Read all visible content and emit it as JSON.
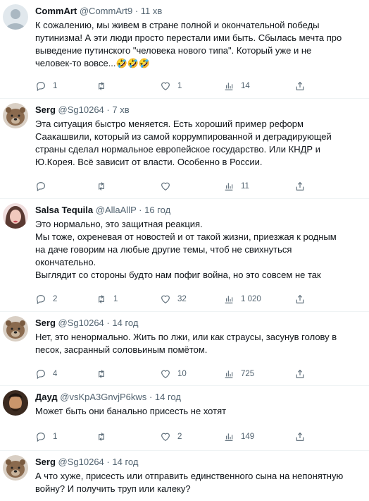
{
  "tweets": [
    {
      "name": "CommArt",
      "handle": "@CommArt9",
      "dot": "·",
      "time": "11 хв",
      "lines": [
        "К сожалению, мы живем в стране полной и окончательной победы",
        "путинизма! А эти люди просто перестали ими быть. Сбылась мечта про",
        "выведение путинского \"человека нового типа\". Который уже и не",
        "человек-то вовсе...🤣🤣🤣"
      ],
      "replies": "1",
      "retweets": "",
      "likes": "1",
      "views": "14"
    },
    {
      "name": "Serg",
      "handle": "@Sg10264",
      "dot": "·",
      "time": "7 хв",
      "lines": [
        "Эта ситуация быстро меняется. Есть хороший пример реформ",
        "Саакашвили, который из самой коррумпированной и деградирующей",
        "страны сделал нормальное европейское государство. Или КНДР и",
        "Ю.Корея. Всё зависит от власти. Особенно в России."
      ],
      "replies": "",
      "retweets": "",
      "likes": "",
      "views": "11"
    },
    {
      "name": "Salsa Tequila",
      "handle": "@AllaAllP",
      "dot": "·",
      "time": "16 год",
      "lines": [
        "Это нормально, это защитная реакция.",
        "Мы тоже, охреневая от новостей и от такой жизни, приезжая к родным",
        "на даче говорим на любые другие темы, чтоб не свихнуться",
        "окончательно.",
        "Выглядит со стороны будто нам пофиг война, но это совсем не так"
      ],
      "replies": "2",
      "retweets": "1",
      "likes": "32",
      "views": "1 020"
    },
    {
      "name": "Serg",
      "handle": "@Sg10264",
      "dot": "·",
      "time": "14 год",
      "lines": [
        "Нет, это ненормально. Жить по лжи, или как страусы, засунув голову в",
        "песок, засранный соловьиным помётом."
      ],
      "replies": "4",
      "retweets": "",
      "likes": "10",
      "views": "725"
    },
    {
      "name": "Дауд",
      "handle": "@vsKpA3GnvjP6kws",
      "dot": "·",
      "time": "14 год",
      "lines": [
        "Может быть они банально присесть не хотят"
      ],
      "replies": "1",
      "retweets": "",
      "likes": "2",
      "views": "149"
    },
    {
      "name": "Serg",
      "handle": "@Sg10264",
      "dot": "·",
      "time": "14 год",
      "lines": [
        "А что хуже, присесть или отправить единственного сына на непонятную",
        "войну? И получить труп или калеку?"
      ],
      "replies": "",
      "retweets": "",
      "likes": "",
      "views": ""
    }
  ],
  "icons": {
    "reply": "reply-icon",
    "retweet": "retweet-icon",
    "like": "like-icon",
    "views": "views-icon",
    "share": "share-icon"
  },
  "colors": {
    "text": "#0f1419",
    "secondary": "#536471",
    "divider": "#eff3f4"
  }
}
